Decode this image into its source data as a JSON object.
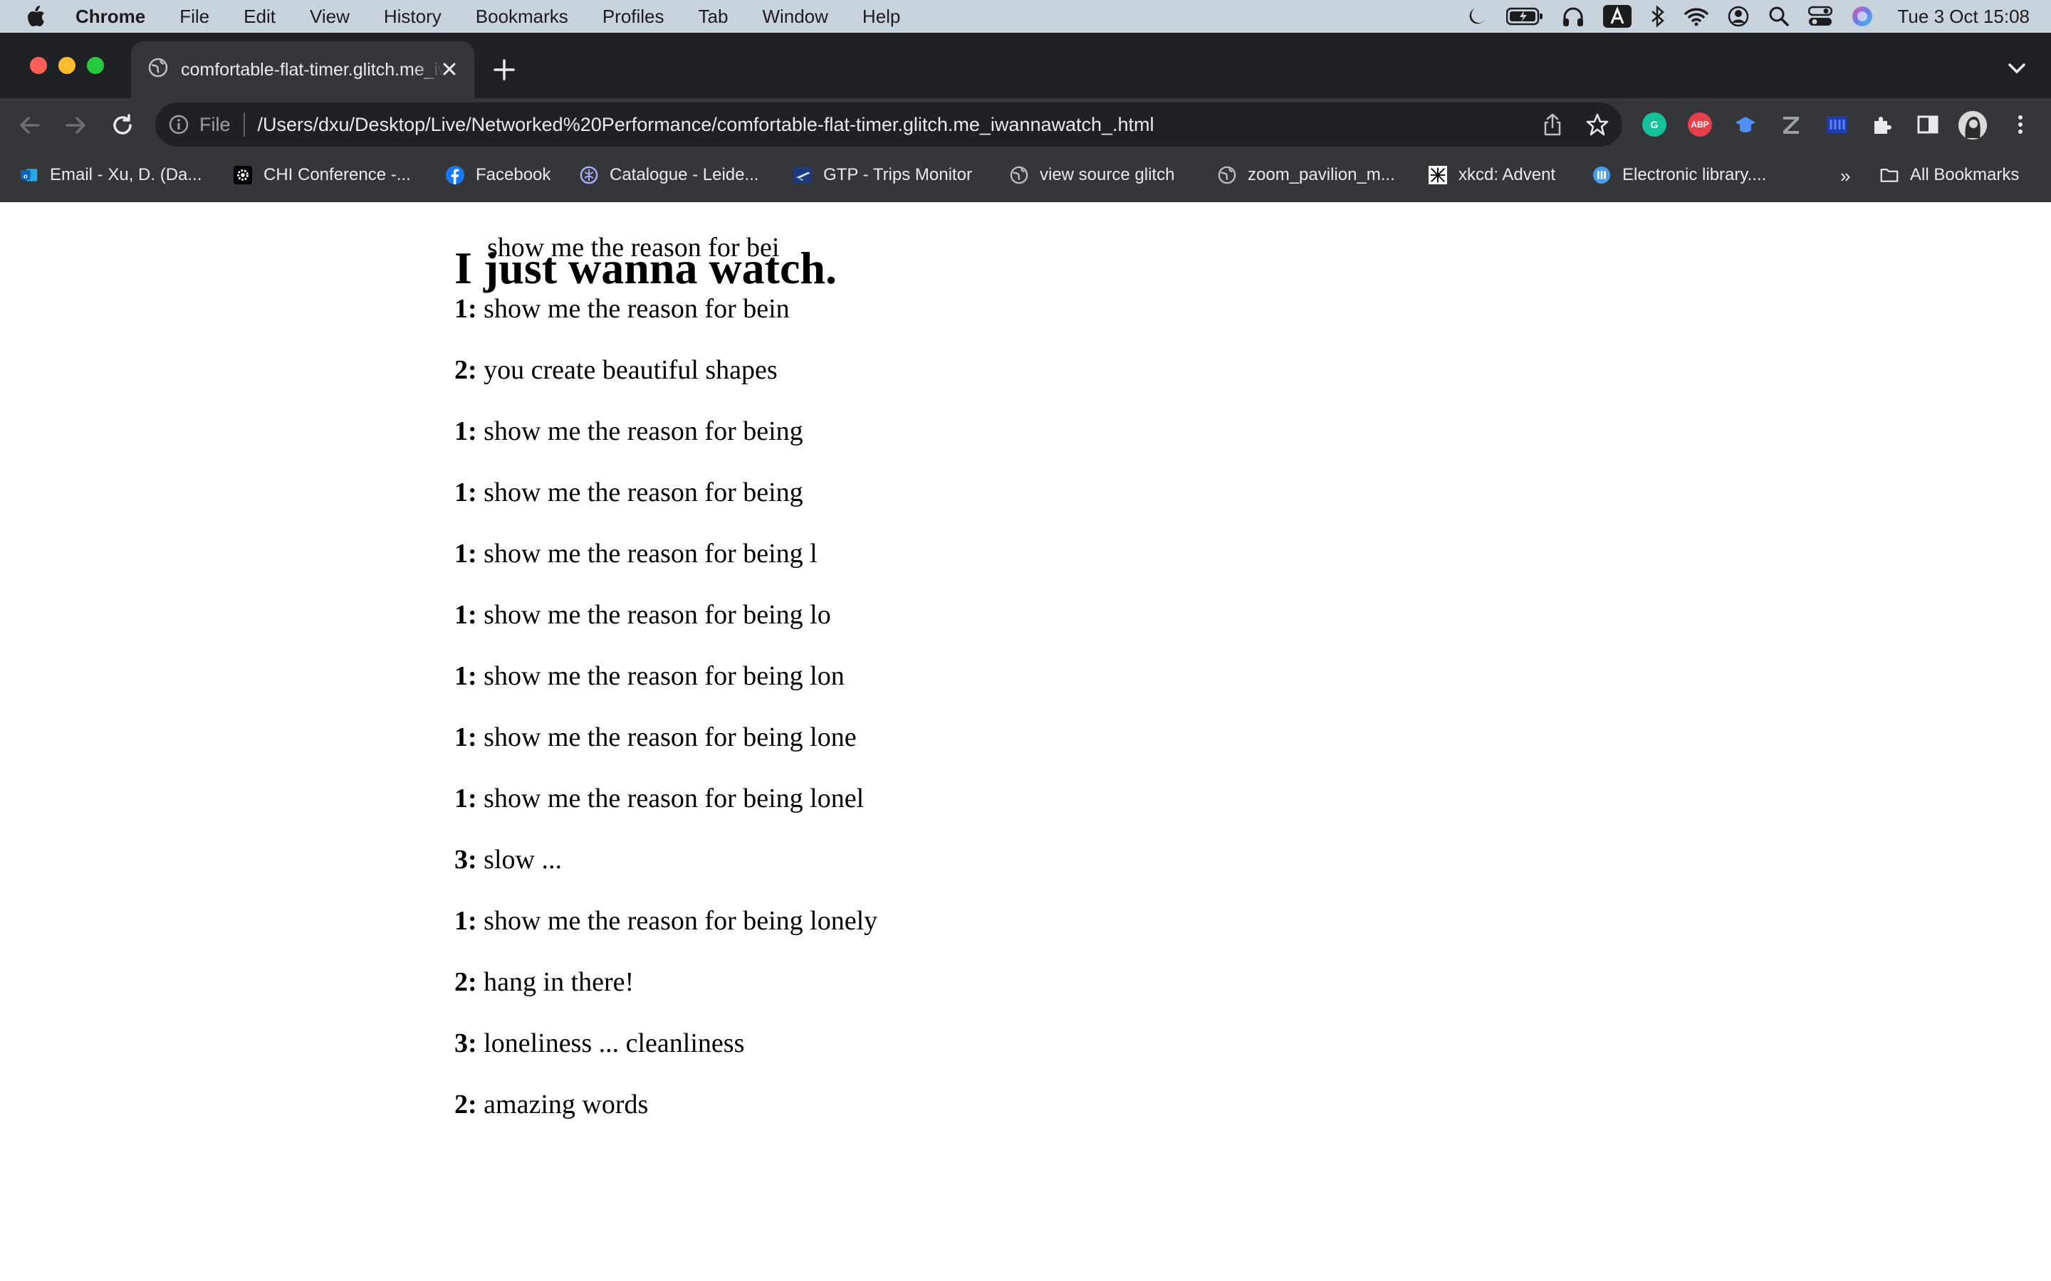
{
  "menubar": {
    "app_name": "Chrome",
    "items": [
      "File",
      "Edit",
      "View",
      "History",
      "Bookmarks",
      "Profiles",
      "Tab",
      "Window",
      "Help"
    ],
    "clock": "Tue 3 Oct  15:08"
  },
  "tab": {
    "title": "comfortable-flat-timer.glitch.me_iwannawatch_.html",
    "close_glyph": "✕",
    "new_tab_glyph": "+"
  },
  "omnibox": {
    "scheme_label": "File",
    "url": "/Users/dxu/Desktop/Live/Networked%20Performance/comfortable-flat-timer.glitch.me_iwannawatch_.html"
  },
  "extensions": [
    "G",
    "ABP"
  ],
  "bookmarks": {
    "items": [
      {
        "label": "Email - Xu, D. (Da...",
        "icon": "outlook-icon"
      },
      {
        "label": "CHI Conference -...",
        "icon": "chi-icon"
      },
      {
        "label": "Facebook",
        "icon": "facebook-icon"
      },
      {
        "label": "Catalogue - Leide...",
        "icon": "leiden-icon"
      },
      {
        "label": "GTP - Trips Monitor",
        "icon": "plane-icon"
      },
      {
        "label": "view source glitch",
        "icon": "globe-icon"
      },
      {
        "label": "zoom_pavilion_m...",
        "icon": "globe-icon"
      },
      {
        "label": "xkcd: Advent",
        "icon": "xkcd-icon"
      },
      {
        "label": "Electronic library....",
        "icon": "library-icon"
      }
    ],
    "overflow_glyph": "»",
    "all_bookmarks": "All Bookmarks"
  },
  "page": {
    "ghost_line": "show me the reason for bei",
    "title": "I just wanna watch.",
    "lines": [
      {
        "speaker": "1:",
        "text": "show me the reason for bein"
      },
      {
        "speaker": "2:",
        "text": "you create beautiful shapes"
      },
      {
        "speaker": "1:",
        "text": "show me the reason for being"
      },
      {
        "speaker": "1:",
        "text": "show me the reason for being"
      },
      {
        "speaker": "1:",
        "text": "show me the reason for being l"
      },
      {
        "speaker": "1:",
        "text": "show me the reason for being lo"
      },
      {
        "speaker": "1:",
        "text": "show me the reason for being lon"
      },
      {
        "speaker": "1:",
        "text": "show me the reason for being lone"
      },
      {
        "speaker": "1:",
        "text": "show me the reason for being lonel"
      },
      {
        "speaker": "3:",
        "text": "slow ..."
      },
      {
        "speaker": "1:",
        "text": "show me the reason for being lonely"
      },
      {
        "speaker": "2:",
        "text": "hang in there!"
      },
      {
        "speaker": "3:",
        "text": "loneliness ... cleanliness"
      },
      {
        "speaker": "2:",
        "text": "amazing words"
      }
    ]
  },
  "colors": {
    "menubar_bg": "#c9d3dc",
    "chrome_dark": "#202124",
    "chrome_toolbar": "#35363a",
    "close_red": "#ff5f57",
    "minimize_yellow": "#febc2e",
    "zoom_green": "#28c840"
  }
}
